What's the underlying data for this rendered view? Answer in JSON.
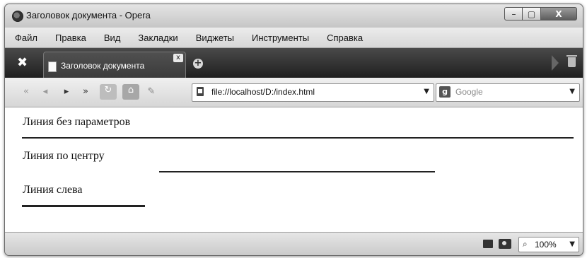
{
  "window": {
    "title": "Заголовок документа - Opera",
    "min_glyph": "–",
    "max_glyph": "▢",
    "close_glyph": "X"
  },
  "menu": [
    "Файл",
    "Правка",
    "Вид",
    "Закладки",
    "Виджеты",
    "Инструменты",
    "Справка"
  ],
  "tabs": [
    {
      "label": "Заголовок документа",
      "close_glyph": "x",
      "active": true
    }
  ],
  "tabbar": {
    "tools_glyph": "✖",
    "new_tab_glyph": "+"
  },
  "nav": {
    "rewind_glyph": "«",
    "back_glyph": "◂",
    "forward_glyph": "▸",
    "ffwd_glyph": "»",
    "reload_glyph": "↻",
    "home_glyph": "⌂",
    "edit_glyph": "✎"
  },
  "address": {
    "url": "file://localhost/D:/index.html",
    "drop_glyph": "▼"
  },
  "search": {
    "engine_glyph": "g",
    "placeholder": "Google",
    "drop_glyph": "▼"
  },
  "content": {
    "line1_label": "Линия без параметров",
    "line2_label": "Линия по центру",
    "line3_label": "Линия слева"
  },
  "status": {
    "zoom_value": "100%",
    "zoom_glyph": "⌕",
    "drop_glyph": "▼"
  },
  "colors": {
    "text": "#111111",
    "tab_bar": "#2a2a2a",
    "rule": "#222222"
  }
}
